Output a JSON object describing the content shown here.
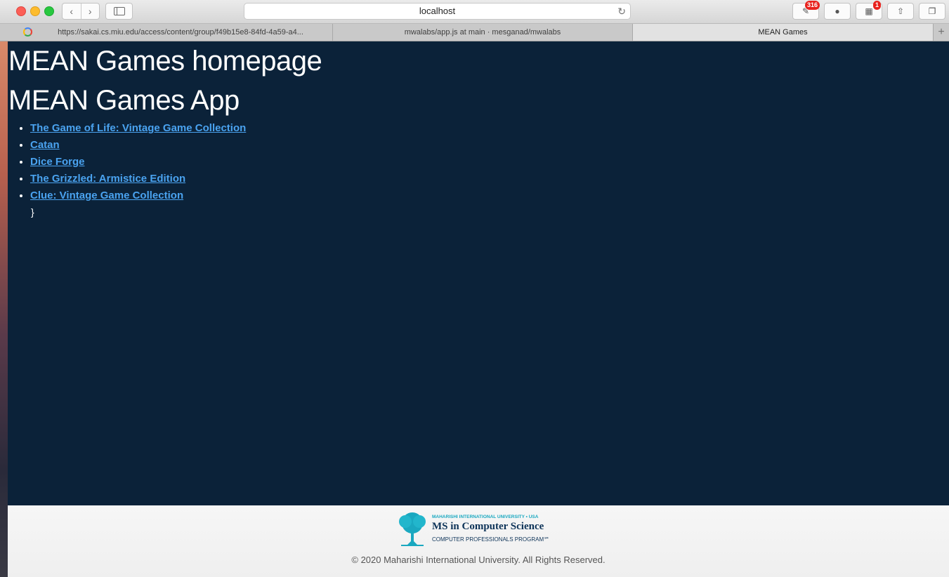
{
  "browser": {
    "url": "localhost",
    "badge_count": "316",
    "notif_count": "1",
    "tabs": [
      {
        "label": "https://sakai.cs.miu.edu/access/content/group/f49b15e8-84fd-4a59-a4..."
      },
      {
        "label": "mwalabs/app.js at main · mesganad/mwalabs"
      },
      {
        "label": "MEAN Games"
      }
    ],
    "new_tab": "+"
  },
  "page": {
    "heading": "MEAN Games homepage",
    "app_title": "MEAN Games App",
    "games": [
      {
        "name": "The Game of Life: Vintage Game Collection"
      },
      {
        "name": "Catan"
      },
      {
        "name": "Dice Forge"
      },
      {
        "name": "The Grizzled: Armistice Edition"
      },
      {
        "name": "Clue: Vintage Game Collection"
      }
    ],
    "stray_text": "}"
  },
  "footer": {
    "logo_university": "MAHARISHI INTERNATIONAL UNIVERSITY • USA",
    "logo_program": "MS in Computer Science",
    "logo_subtitle": "COMPUTER PROFESSIONALS PROGRAM℠",
    "copyright": "© 2020 Maharishi International University. All Rights Reserved."
  },
  "colors": {
    "page_bg": "#0b2239",
    "link": "#4aa3f0",
    "logo_teal": "#1aa8c0",
    "logo_navy": "#0d3358"
  }
}
